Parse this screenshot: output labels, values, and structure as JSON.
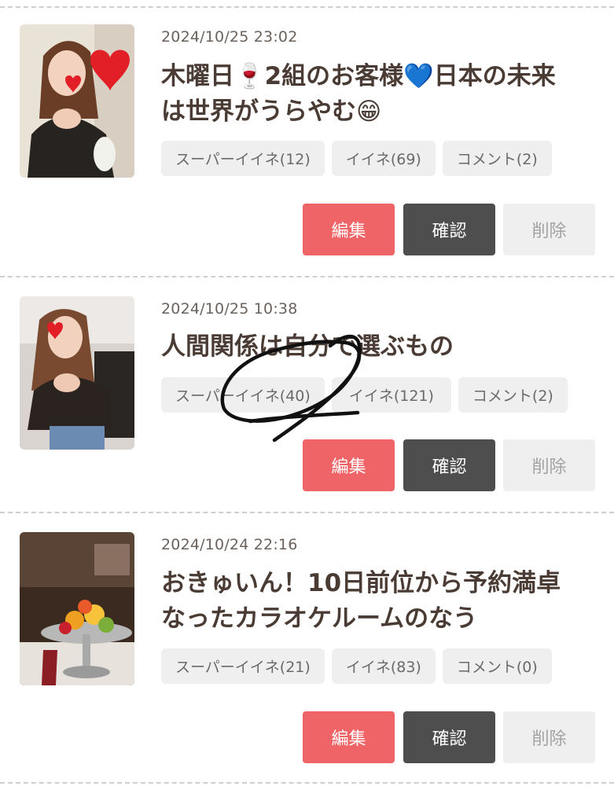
{
  "posts": [
    {
      "date": "2024/10/25 23:02",
      "title_line1": "木曜日🍷2組のお客様💙日本の未来",
      "title_line2": "は世界がうらやむ😁",
      "tags": [
        "スーパーイイネ(12)",
        "イイネ(69)",
        "コメント(2)"
      ],
      "buttons": {
        "edit": "編集",
        "confirm": "確認",
        "delete": "削除"
      }
    },
    {
      "date": "2024/10/25 10:38",
      "title_line1": "人間関係は自分で選ぶもの",
      "title_line2": "",
      "tags": [
        "スーパーイイネ(40)",
        "イイネ(121)",
        "コメント(2)"
      ],
      "buttons": {
        "edit": "編集",
        "confirm": "確認",
        "delete": "削除"
      }
    },
    {
      "date": "2024/10/24 22:16",
      "title_line1": "おきゅいん！10日前位から予約満卓",
      "title_line2": "なったカラオケルームのなう",
      "tags": [
        "スーパーイイネ(21)",
        "イイネ(83)",
        "コメント(0)"
      ],
      "buttons": {
        "edit": "編集",
        "confirm": "確認",
        "delete": "削除"
      }
    }
  ],
  "colors": {
    "edit": "#ef6466",
    "confirm": "#4f4e4e",
    "delete": "#efefef",
    "tag": "#efefef",
    "divider": "#cfcfcf"
  }
}
